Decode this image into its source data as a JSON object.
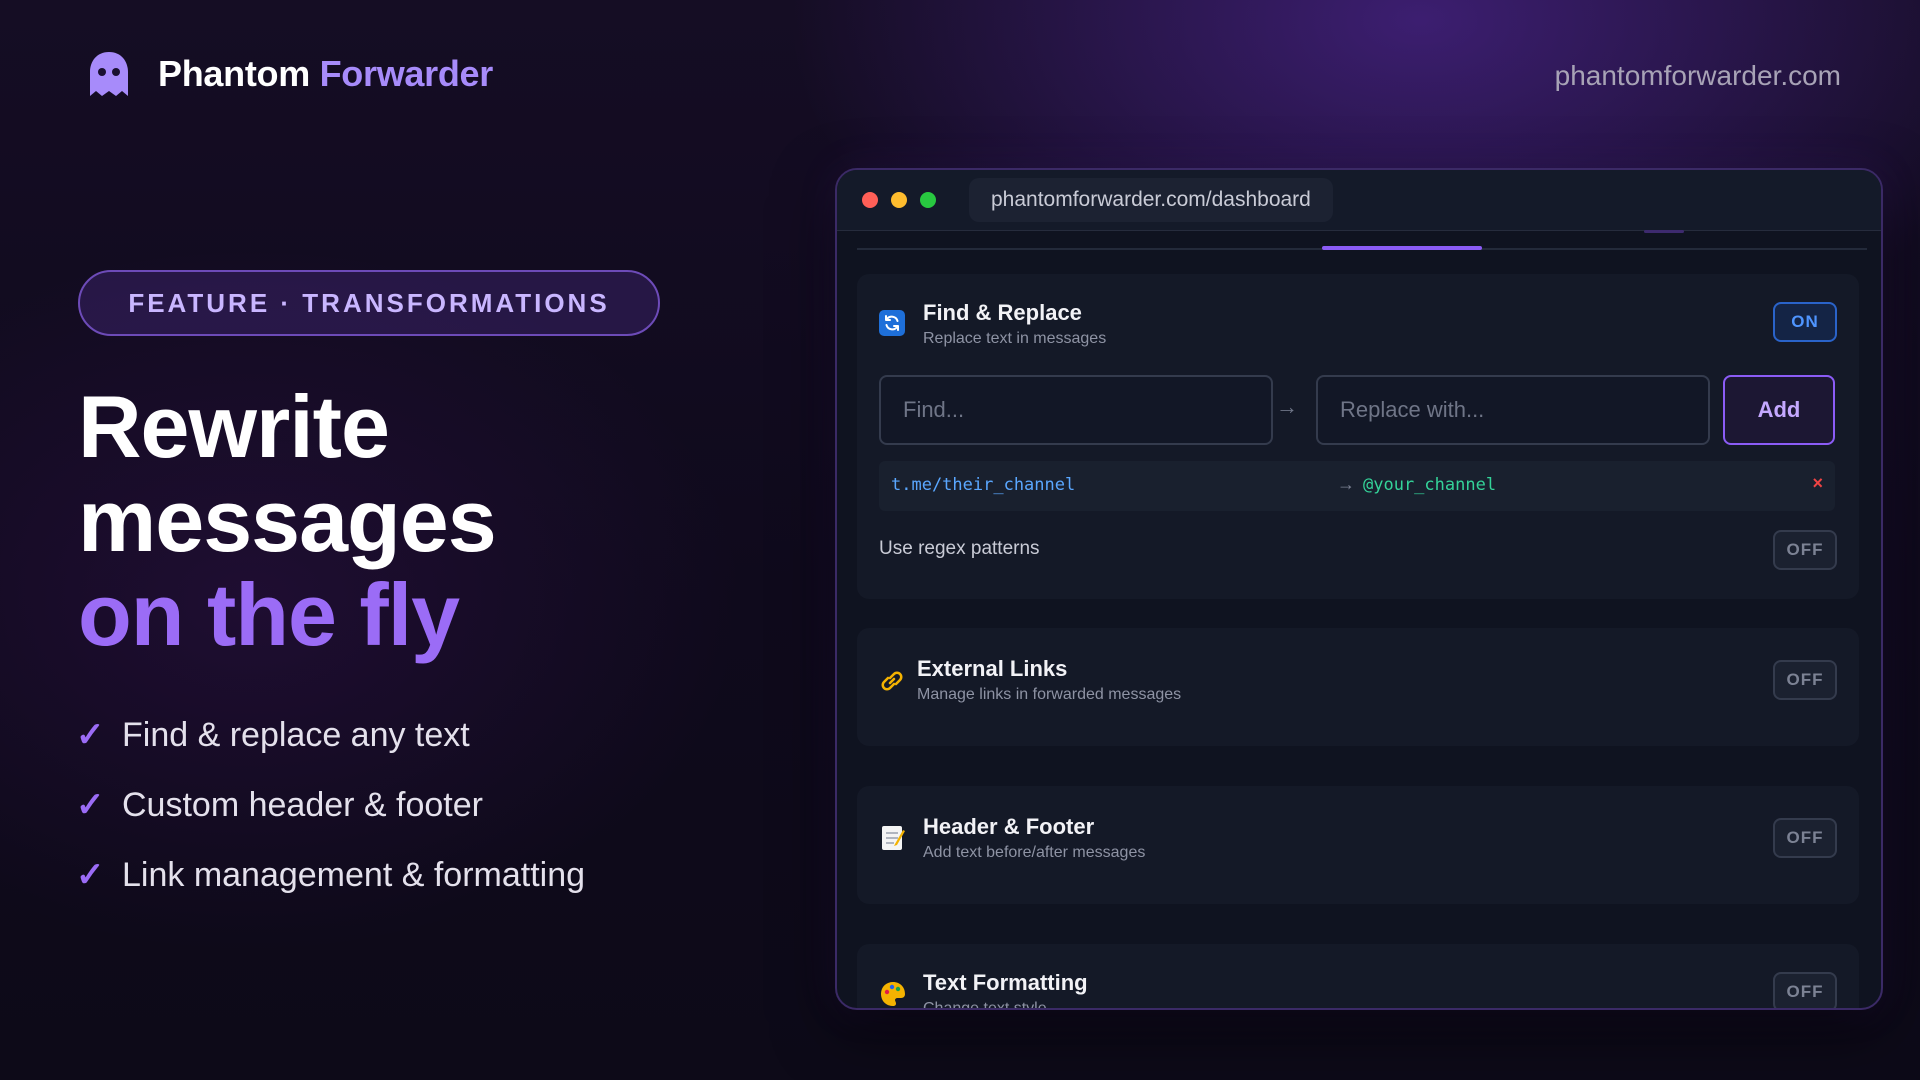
{
  "brand": {
    "name_part1": "Phantom",
    "name_part2": "Forwarder",
    "icon": "ghost-icon"
  },
  "site_url": "phantomforwarder.com",
  "badge": "FEATURE · TRANSFORMATIONS",
  "headline": {
    "line1": "Rewrite",
    "line2": "messages",
    "line3": "on the fly"
  },
  "features": [
    {
      "icon": "checkmark-icon",
      "check": "✓",
      "label": "Find & replace any text"
    },
    {
      "icon": "checkmark-icon",
      "check": "✓",
      "label": "Custom header & footer"
    },
    {
      "icon": "checkmark-icon",
      "check": "✓",
      "label": "Link management & formatting"
    }
  ],
  "browser": {
    "url": "phantomforwarder.com/dashboard",
    "window_controls": [
      "close",
      "minimize",
      "maximize"
    ]
  },
  "cards": {
    "find_replace": {
      "icon": "refresh-icon",
      "title": "Find & Replace",
      "subtitle": "Replace text in messages",
      "toggle": "ON",
      "find_placeholder": "Find...",
      "arrow": "→",
      "replace_placeholder": "Replace with...",
      "add_label": "Add",
      "rule": {
        "find": "t.me/their_channel",
        "arrow": "→",
        "replace": "@your_channel",
        "delete": "×"
      },
      "regex_label": "Use regex patterns",
      "regex_toggle": "OFF"
    },
    "external_links": {
      "icon": "link-icon",
      "title": "External Links",
      "subtitle": "Manage links in forwarded messages",
      "toggle": "OFF"
    },
    "header_footer": {
      "icon": "memo-icon",
      "title": "Header & Footer",
      "subtitle": "Add text before/after messages",
      "toggle": "OFF"
    },
    "text_formatting": {
      "icon": "palette-icon",
      "title": "Text Formatting",
      "subtitle": "Change text style",
      "toggle": "OFF"
    }
  },
  "colors": {
    "accent": "#9b6cf6",
    "toggle_on": "#4f95ff",
    "rule_find": "#5aa7ff",
    "rule_replace": "#34d399",
    "delete": "#ef4444"
  }
}
